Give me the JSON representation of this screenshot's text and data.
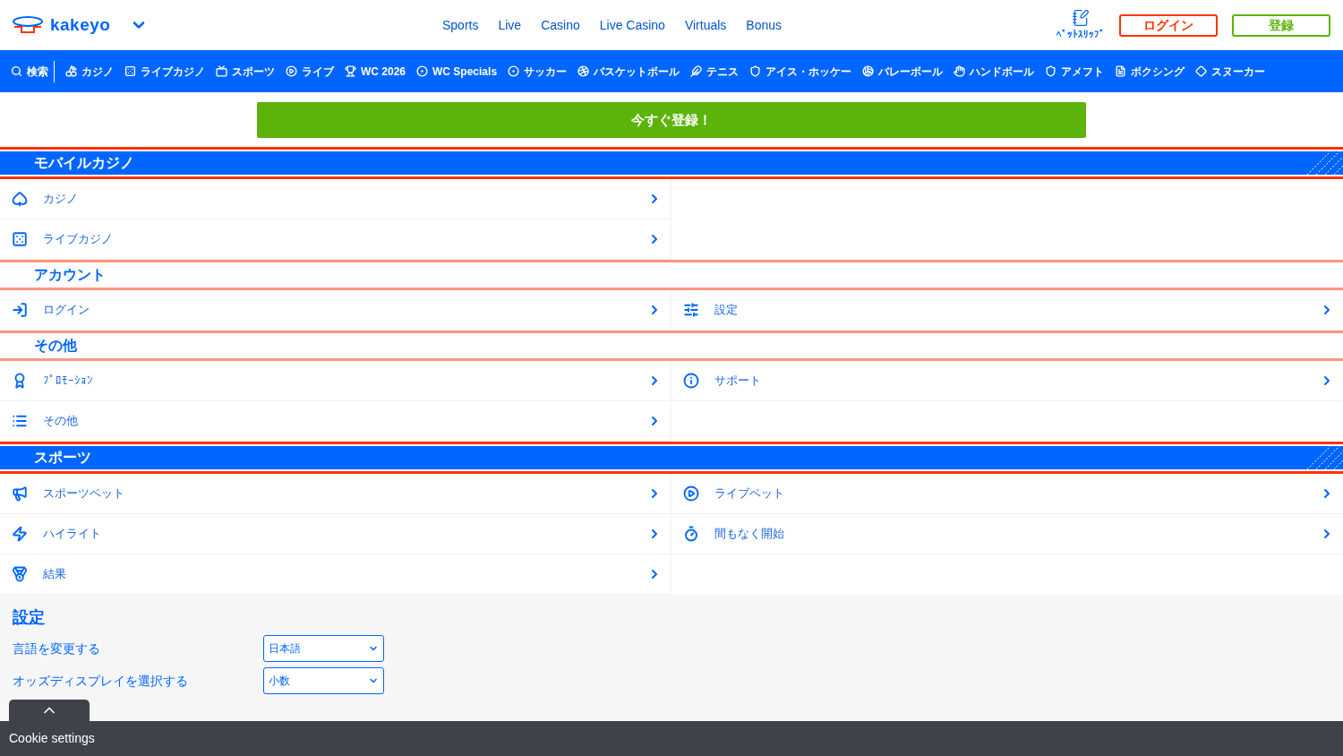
{
  "header": {
    "logo": "kakeyo",
    "links": [
      "Sports",
      "Live",
      "Casino",
      "Live Casino",
      "Virtuals",
      "Bonus"
    ],
    "betslip": "ﾍﾞｯﾄｽﾘｯﾌﾟ",
    "login": "ログイン",
    "register": "登録"
  },
  "nav": [
    "検索",
    "カジノ",
    "ライブカジノ",
    "スポーツ",
    "ライブ",
    "WC 2026",
    "WC Specials",
    "サッカー",
    "バスケットボール",
    "テニス",
    "アイス・ホッケー",
    "バレーボール",
    "ハンドボール",
    "アメフト",
    "ボクシング",
    "スヌーカー"
  ],
  "cta": "今すぐ登録！",
  "sections": [
    {
      "title": "モバイルカジノ",
      "kind": "banner",
      "rows": [
        [
          {
            "label": "カジノ"
          }
        ],
        [
          {
            "label": "ライブカジノ"
          }
        ]
      ]
    },
    {
      "title": "アカウント",
      "kind": "plain",
      "rows": [
        [
          {
            "label": "ログイン"
          },
          {
            "label": "設定"
          }
        ]
      ]
    },
    {
      "title": "その他",
      "kind": "plain",
      "rows": [
        [
          {
            "label": "ﾌﾟﾛﾓｰｼｮﾝ"
          },
          {
            "label": "サポート"
          }
        ],
        [
          {
            "label": "その他"
          }
        ]
      ]
    },
    {
      "title": "スポーツ",
      "kind": "banner",
      "rows": [
        [
          {
            "label": "スポーツベット"
          },
          {
            "label": "ライブベット"
          }
        ],
        [
          {
            "label": "ハイライト"
          },
          {
            "label": "間もなく開始"
          }
        ],
        [
          {
            "label": "結果"
          }
        ]
      ]
    }
  ],
  "settings": {
    "title": "設定",
    "fields": [
      {
        "label": "言語を変更する",
        "value": "日本語"
      },
      {
        "label": "オッズディスプレイを選択する",
        "value": "小数"
      }
    ]
  },
  "cookie": "Cookie settings"
}
